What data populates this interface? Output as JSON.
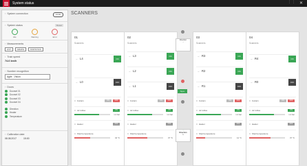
{
  "app": {
    "title": "System status"
  },
  "sidebar": {
    "connection": {
      "label": "System connection",
      "value": "Local"
    },
    "system_status": {
      "label": "System status",
      "hint": "Reset",
      "items": [
        {
          "label": "Idle",
          "color": "#3aa655"
        },
        {
          "label": "Warning",
          "color": "#e5a23a"
        },
        {
          "label": "Error",
          "color": "#e06363"
        }
      ]
    },
    "measurements": {
      "label": "Measurements",
      "buttons": [
        "LIST",
        "GRAPH",
        "STATISTICS"
      ]
    },
    "train_speed": {
      "label": "Train speed",
      "value": "74.6 km/h"
    },
    "number_recognition": {
      "label": "Number recognition",
      "value": "Agile - Vision"
    },
    "doors": {
      "label": "Doors",
      "items": [
        "Doorset 01",
        "Doorset 02",
        "Doorset 03",
        "Doorset 04"
      ]
    },
    "modes": [
      "Direction",
      "Heater",
      "Temperature"
    ],
    "calibration": {
      "label": "Calibration date",
      "date": "08.08.2017",
      "time": "15:00"
    }
  },
  "main": {
    "title": "SCANNERS"
  },
  "scanners": [
    {
      "name": "01",
      "sub": "Scanners",
      "zones": [
        {
          "label": "L4",
          "state": "ON",
          "color": "green"
        },
        {
          "label": "L0",
          "state": "OFF",
          "color": "dark"
        }
      ],
      "curtain": {
        "label": "Curtain",
        "a": "ON",
        "b": "OFF"
      },
      "air_knife": {
        "label": "Air knifes",
        "value": "1.2 bar",
        "level": 0.7
      },
      "heater": {
        "label": "Heater",
        "state": "OFF"
      },
      "shell": {
        "label": "Shell temperature",
        "value": "34 °C",
        "level": 0.45
      }
    },
    {
      "name": "02",
      "sub": "Scanners",
      "zones": [
        {
          "label": "L3",
          "state": "ON",
          "color": "green"
        },
        {
          "label": "L2",
          "state": "ON",
          "color": "green"
        },
        {
          "label": "L1",
          "state": "OFF",
          "color": "dark"
        }
      ],
      "curtain": {
        "label": "Curtain",
        "a": "ON",
        "b": "OFF"
      },
      "air_knife": {
        "label": "Air knifes",
        "value": "1.2 bar",
        "level": 0.7
      },
      "heater": {
        "label": "Heater",
        "state": "OFF"
      },
      "shell": {
        "label": "Shell temperature",
        "value": "37 °C",
        "level": 0.55
      }
    },
    {
      "name": "03",
      "sub": "Scanners",
      "zones": [
        {
          "label": "R3",
          "state": "ON",
          "color": "green"
        },
        {
          "label": "R2",
          "state": "ON",
          "color": "green"
        },
        {
          "label": "R1",
          "state": "OFF",
          "color": "dark"
        }
      ],
      "curtain": {
        "label": "Curtain",
        "a": "ON",
        "b": "OFF"
      },
      "air_knife": {
        "label": "Air knifes",
        "value": "1.2 bar",
        "level": 0.7
      },
      "heater": {
        "label": "Heater",
        "state": "OFF"
      },
      "shell": {
        "label": "Shell temperature",
        "value": "14 °C",
        "level": 0.25
      }
    },
    {
      "name": "04",
      "sub": "Scanners",
      "zones": [
        {
          "label": "R4",
          "state": "ON",
          "color": "green"
        },
        {
          "label": "R0",
          "state": "OFF",
          "color": "dark"
        }
      ],
      "curtain": {
        "label": "Curtain",
        "a": "ON",
        "b": "OFF"
      },
      "air_knife": {
        "label": "Air knifes",
        "value": "1.2 bar",
        "level": 0.7
      },
      "heater": {
        "label": "Heater",
        "state": "OFF"
      },
      "shell": {
        "label": "Shell temperature",
        "value": "37 °C",
        "level": 0.6
      }
    }
  ],
  "center": {
    "direction_top": "Direction",
    "direction_bottom": "Direction",
    "direction_bottom_num": "1",
    "sync": "Sync"
  }
}
